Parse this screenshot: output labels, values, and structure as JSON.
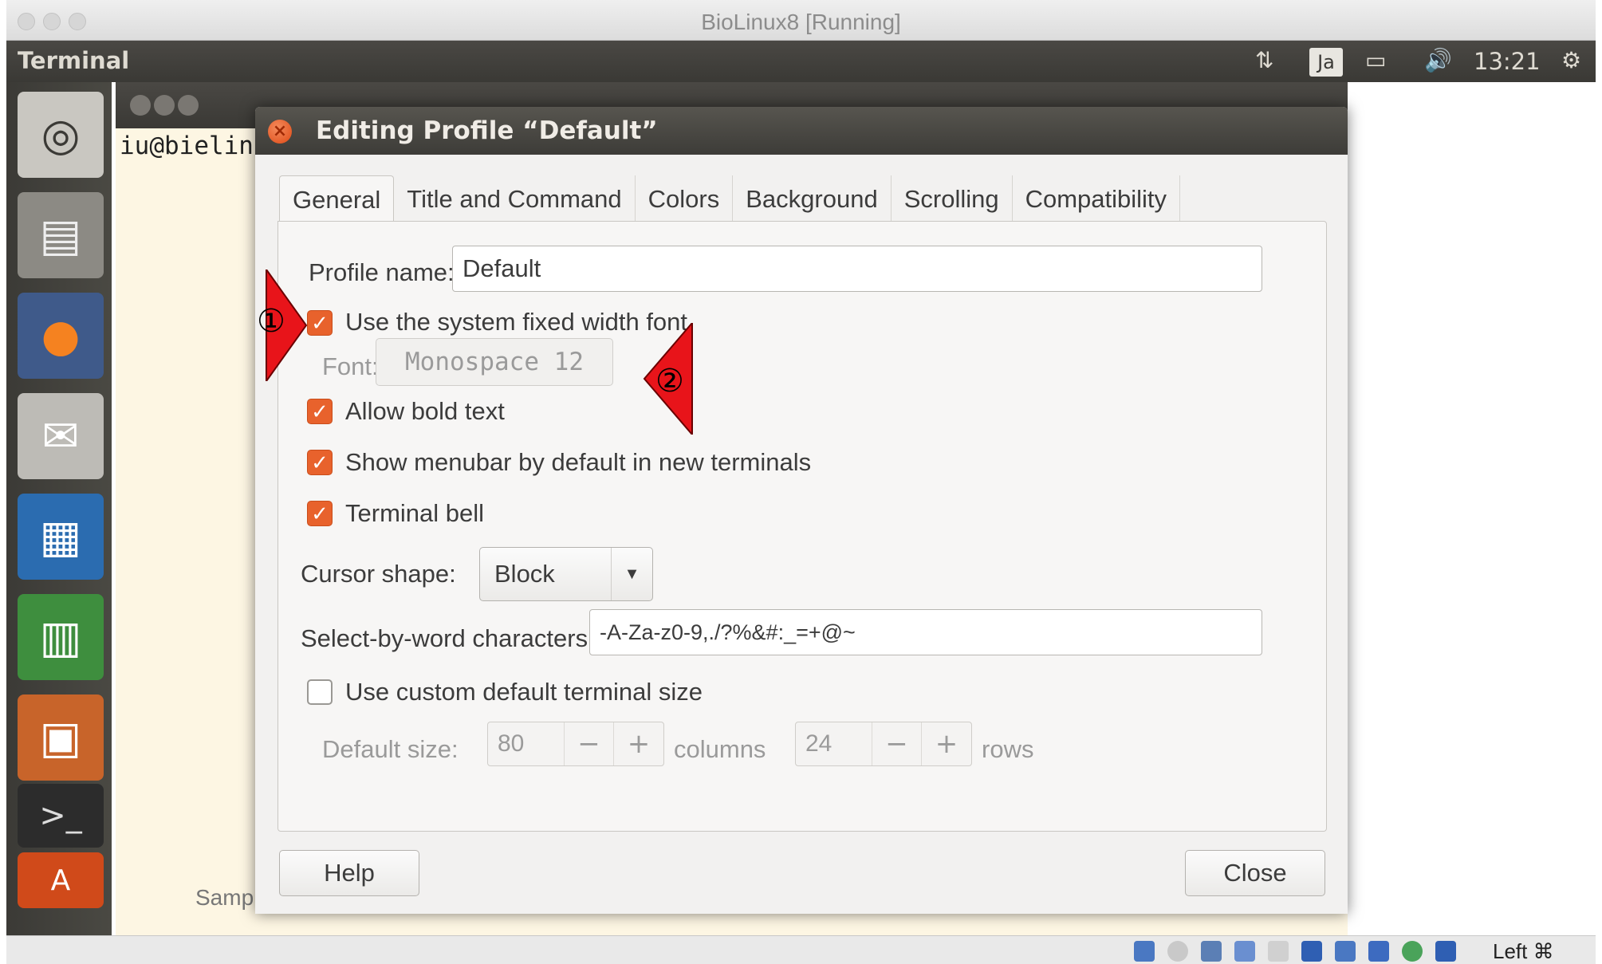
{
  "window": {
    "title": "BioLinux8 [Running]"
  },
  "ubuntu_panel": {
    "app_name": "Terminal",
    "keyboard_layout": "Ja",
    "clock": "13:21"
  },
  "terminal": {
    "prompt": "iu@bielin",
    "sample_text": "Samp"
  },
  "dialog": {
    "title": "Editing Profile “Default”",
    "tabs": [
      "General",
      "Title and Command",
      "Colors",
      "Background",
      "Scrolling",
      "Compatibility"
    ],
    "active_tab": "General",
    "profile_name_label": "Profile name:",
    "profile_name_value": "Default",
    "use_system_font_label": "Use the system fixed width font",
    "use_system_font_checked": true,
    "font_label": "Font:",
    "font_value": "Monospace   12",
    "allow_bold_label": "Allow bold text",
    "allow_bold_checked": true,
    "show_menubar_label": "Show menubar by default in new terminals",
    "show_menubar_checked": true,
    "terminal_bell_label": "Terminal bell",
    "terminal_bell_checked": true,
    "cursor_shape_label": "Cursor shape:",
    "cursor_shape_value": "Block",
    "select_by_word_label": "Select-by-word characters:",
    "select_by_word_value": "-A-Za-z0-9,./?%&#:_=+@~",
    "custom_size_label": "Use custom default terminal size",
    "custom_size_checked": false,
    "default_size_label": "Default size:",
    "columns_value": "80",
    "columns_label": "columns",
    "rows_value": "24",
    "rows_label": "rows",
    "help_button": "Help",
    "close_button": "Close"
  },
  "annotations": {
    "marker1": "①",
    "marker2": "②",
    "color": "#e8141a"
  },
  "vbox_status": {
    "host_key": "Left ⌘"
  },
  "colors": {
    "accent": "#e8622c",
    "panel": "#3a3935",
    "dialog_bg": "#f2f1f0"
  }
}
